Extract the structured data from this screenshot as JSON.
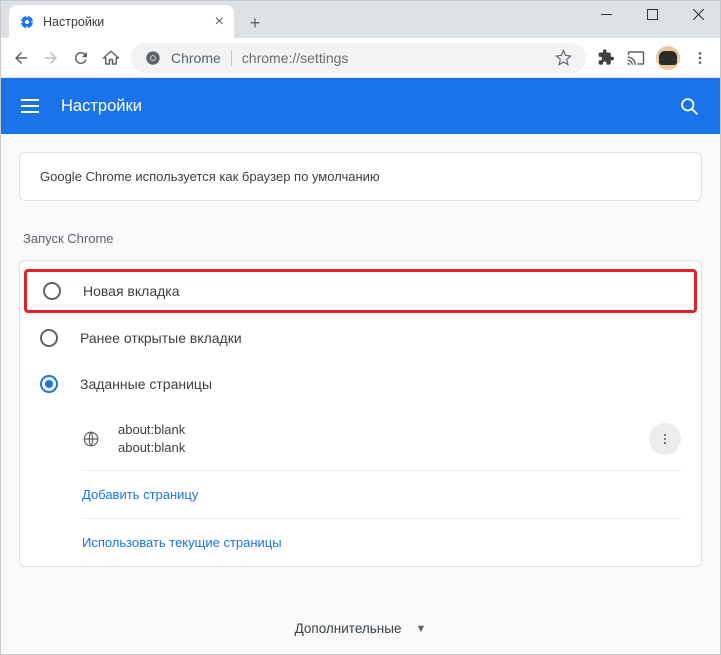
{
  "window": {
    "tab_title": "Настройки"
  },
  "toolbar": {
    "chrome_label": "Chrome",
    "address": "chrome://settings"
  },
  "header": {
    "title": "Настройки"
  },
  "default_browser_card": "Google Chrome используется как браузер по умолчанию",
  "startup": {
    "section_title": "Запуск Chrome",
    "options": [
      {
        "label": "Новая вкладка"
      },
      {
        "label": "Ранее открытые вкладки"
      },
      {
        "label": "Заданные страницы"
      }
    ],
    "pages": [
      {
        "title": "about:blank",
        "url": "about:blank"
      }
    ],
    "add_page": "Добавить страницу",
    "use_current": "Использовать текущие страницы"
  },
  "more": "Дополнительные"
}
